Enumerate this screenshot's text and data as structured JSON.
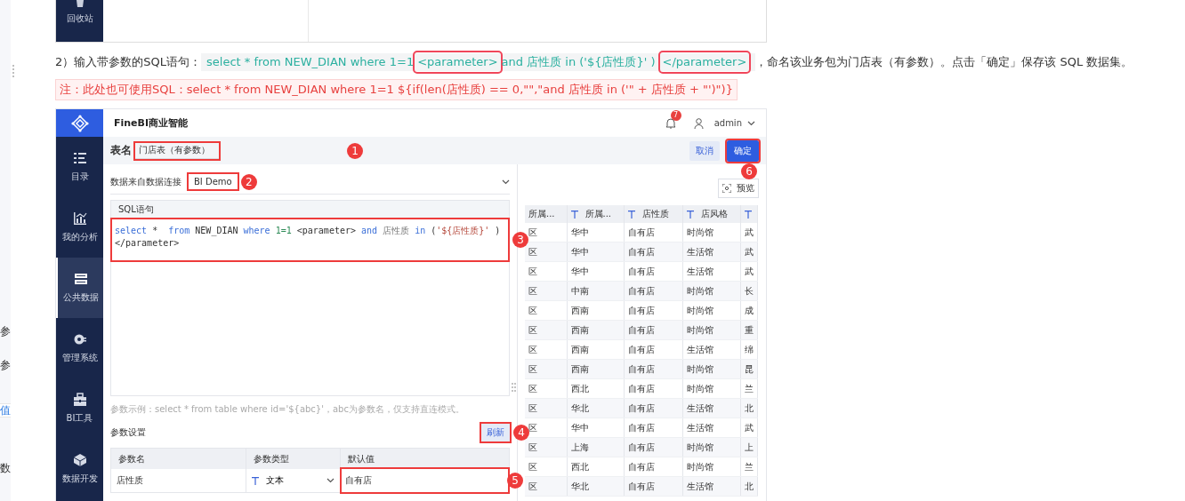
{
  "left_edge": [
    "参",
    "参",
    "值",
    "数"
  ],
  "top_fragment": {
    "sidebar_label": "回收站"
  },
  "step": {
    "prefix": "2）输入带参数的SQL语句：",
    "code": [
      {
        "text": "select *  from NEW_DIAN where 1=1",
        "highlighted": false
      },
      {
        "text": "<parameter>",
        "highlighted": true
      },
      {
        "text": "and 店性质 in ('${店性质}' )",
        "highlighted": false
      },
      {
        "text": "</parameter>",
        "highlighted": true
      }
    ],
    "suffix": "，命名该业务包为门店表（有参数）。点击「确定」保存该 SQL 数据集。"
  },
  "note": "注：此处也可使用SQL：select * from NEW_DIAN where 1=1 ${if(len(店性质) == 0,\"\",\"and 店性质 in ('\" + 店性质 + \"')\")}",
  "app": {
    "brand": "FineBI商业智能",
    "notifications": "7",
    "user": "admin",
    "nav": [
      {
        "label": "目录",
        "selected": false
      },
      {
        "label": "我的分析",
        "selected": false
      },
      {
        "label": "公共数据",
        "selected": true
      },
      {
        "label": "管理系统",
        "selected": false
      },
      {
        "label": "BI工具",
        "selected": false
      },
      {
        "label": "数据开发",
        "selected": false
      }
    ],
    "table_name_label": "表名",
    "table_name": "门店表（有参数）",
    "cancel": "取消",
    "confirm": "确定",
    "connection_label": "数据来自数据连接",
    "connection": "BI Demo",
    "sql_label": "SQL语句",
    "sql": [
      {
        "text": "select",
        "kind": "keyword"
      },
      {
        "text": " *  ",
        "kind": "plain"
      },
      {
        "text": "from",
        "kind": "keyword"
      },
      {
        "text": " NEW_DIAN ",
        "kind": "plain"
      },
      {
        "text": "where",
        "kind": "keyword"
      },
      {
        "text": " 1=1",
        "kind": "number"
      },
      {
        "text": " <parameter> ",
        "kind": "plain"
      },
      {
        "text": "and",
        "kind": "keyword"
      },
      {
        "text": " 店性质 ",
        "kind": "cjk"
      },
      {
        "text": "in",
        "kind": "keyword"
      },
      {
        "text": " (",
        "kind": "plain"
      },
      {
        "text": "'${店性质}'",
        "kind": "string"
      },
      {
        "text": " ) </parameter>",
        "kind": "plain"
      }
    ],
    "hint": "参数示例：select * from table where id='${abc}'，abc为参数名，仅支持直连模式。",
    "param_settings": "参数设置",
    "refresh": "刷新",
    "param_columns": [
      "参数名",
      "参数类型",
      "默认值"
    ],
    "params": [
      {
        "name": "店性质",
        "type": "文本",
        "default": "自有店"
      }
    ],
    "preview": "预览",
    "preview_columns": [
      {
        "label": "所属...",
        "typed": false
      },
      {
        "label": "所属...",
        "typed": true
      },
      {
        "label": "店性质",
        "typed": true
      },
      {
        "label": "店风格",
        "typed": true
      },
      {
        "typed": true
      }
    ],
    "preview_rows": [
      [
        "区",
        "华中",
        "自有店",
        "时尚馆",
        "武"
      ],
      [
        "区",
        "华中",
        "自有店",
        "生活馆",
        "武"
      ],
      [
        "区",
        "华中",
        "自有店",
        "生活馆",
        "武"
      ],
      [
        "区",
        "中南",
        "自有店",
        "时尚馆",
        "长"
      ],
      [
        "区",
        "西南",
        "自有店",
        "时尚馆",
        "成"
      ],
      [
        "区",
        "西南",
        "自有店",
        "时尚馆",
        "重"
      ],
      [
        "区",
        "西南",
        "自有店",
        "生活馆",
        "绵"
      ],
      [
        "区",
        "西南",
        "自有店",
        "时尚馆",
        "昆"
      ],
      [
        "区",
        "西北",
        "自有店",
        "时尚馆",
        "兰"
      ],
      [
        "区",
        "华北",
        "自有店",
        "生活馆",
        "北"
      ],
      [
        "区",
        "华中",
        "自有店",
        "生活馆",
        "武"
      ],
      [
        "区",
        "上海",
        "自有店",
        "时尚馆",
        "上"
      ],
      [
        "区",
        "西北",
        "自有店",
        "时尚馆",
        "兰"
      ],
      [
        "区",
        "华北",
        "自有店",
        "生活馆",
        "北"
      ]
    ],
    "markers": {
      "table_name": "1",
      "connection": "2",
      "sql": "3",
      "refresh": "4",
      "default_value": "5",
      "confirm": "6"
    }
  }
}
